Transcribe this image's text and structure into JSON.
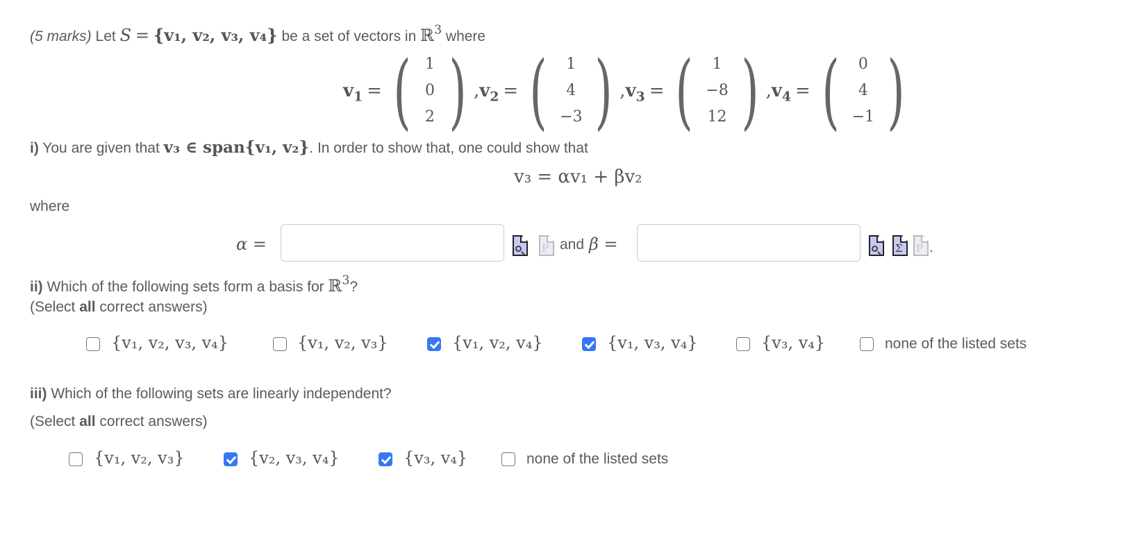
{
  "question": {
    "marks": "(5 marks)",
    "intro_let": "Let",
    "set_name": "S",
    "equals": "=",
    "set_contents": "{v₁, v₂, v₃, v₄}",
    "intro_rest": "be a set of vectors in",
    "space": "ℝ",
    "space_exp": "3",
    "intro_where": "where"
  },
  "vectors": [
    {
      "name": "v",
      "index": "1",
      "components": [
        "1",
        "0",
        "2"
      ]
    },
    {
      "name": "v",
      "index": "2",
      "components": [
        "1",
        "4",
        "−3"
      ]
    },
    {
      "name": "v",
      "index": "3",
      "components": [
        "1",
        "−8",
        "12"
      ]
    },
    {
      "name": "v",
      "index": "4",
      "components": [
        "0",
        "4",
        "−1"
      ]
    }
  ],
  "part_i": {
    "label": "i)",
    "text_before": "You are given that",
    "membership": "v₃ ∈ span{v₁, v₂}",
    "text_after": ". In order to show that, one could show that",
    "equation": "v₃ = αv₁ + βv₂",
    "where": "where",
    "alpha_label": "α =",
    "alpha_value": "",
    "and_label": "and",
    "beta_label": "β =",
    "beta_value": "",
    "trailing_dot": "."
  },
  "part_ii": {
    "label": "ii)",
    "question": "Which of the following sets form a basis for",
    "space": "ℝ",
    "space_exp": "3",
    "qmark": "?",
    "instruction_pre": "(Select ",
    "instruction_bold": "all",
    "instruction_post": " correct answers)",
    "options": [
      {
        "label": "{v₁, v₂, v₃, v₄}",
        "checked": false
      },
      {
        "label": "{v₁, v₂, v₃}",
        "checked": false
      },
      {
        "label": "{v₁, v₂, v₄}",
        "checked": true
      },
      {
        "label": "{v₁, v₃, v₄}",
        "checked": true
      },
      {
        "label": "{v₃, v₄}",
        "checked": false
      },
      {
        "label": "none of the listed sets",
        "checked": false
      }
    ]
  },
  "part_iii": {
    "label": "iii)",
    "question": "Which of the following sets are linearly independent?",
    "instruction_pre": "(Select ",
    "instruction_bold": "all",
    "instruction_post": " correct answers)",
    "options": [
      {
        "label": "{v₁, v₂, v₃}",
        "checked": false
      },
      {
        "label": "{v₂, v₃, v₄}",
        "checked": true
      },
      {
        "label": "{v₃, v₄}",
        "checked": true
      },
      {
        "label": "none of the listed sets",
        "checked": false
      }
    ]
  },
  "icons": {
    "preview": "preview-icon",
    "equation_editor": "equation-editor-icon",
    "plain_text": "plain-text-icon"
  },
  "colors": {
    "checkbox_checked": "#3478f6",
    "text": "#5a5a5a",
    "icon_fill": "#c8c8f2"
  }
}
